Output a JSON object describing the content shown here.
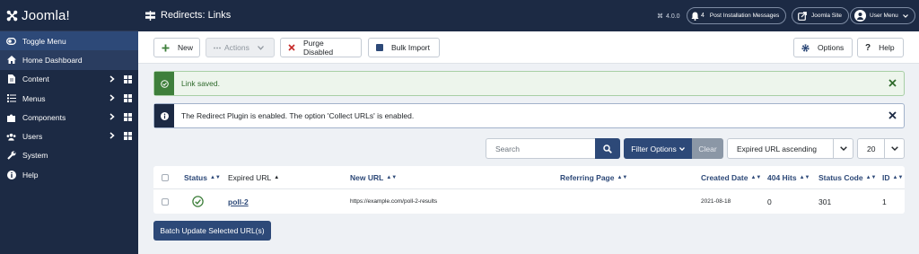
{
  "brand": {
    "name": "Joomla!"
  },
  "sidebar": {
    "items": [
      {
        "label": "Toggle Menu",
        "icon": "toggle-icon"
      },
      {
        "label": "Home Dashboard",
        "icon": "home-icon"
      },
      {
        "label": "Content",
        "icon": "file-icon"
      },
      {
        "label": "Menus",
        "icon": "list-icon"
      },
      {
        "label": "Components",
        "icon": "puzzle-icon"
      },
      {
        "label": "Users",
        "icon": "users-icon"
      },
      {
        "label": "System",
        "icon": "wrench-icon"
      },
      {
        "label": "Help",
        "icon": "info-icon"
      }
    ]
  },
  "header": {
    "title": "Redirects: Links",
    "version": "4.0.0",
    "notifications": {
      "count": "4",
      "label": "Post Installation Messages"
    },
    "site_link": "Joomla Site",
    "user_menu": "User Menu"
  },
  "toolbar": {
    "new_label": "New",
    "actions_label": "Actions",
    "purge_label": "Purge Disabled",
    "bulk_label": "Bulk Import",
    "options_label": "Options",
    "help_label": "Help"
  },
  "alerts": {
    "success": "Link saved.",
    "info": "The Redirect Plugin is enabled. The option 'Collect URLs' is enabled."
  },
  "filters": {
    "search_placeholder": "Search",
    "filter_options_label": "Filter Options",
    "clear_label": "Clear",
    "ordering": "Expired URL ascending",
    "limit": "20"
  },
  "table": {
    "headers": {
      "status": "Status",
      "expired_url": "Expired URL",
      "new_url": "New URL",
      "referring_page": "Referring Page",
      "created_date": "Created Date",
      "hits": "404 Hits",
      "status_code": "Status Code",
      "id": "ID"
    },
    "rows": [
      {
        "expired_url": "poll-2",
        "new_url": "https://example.com/poll-2-results",
        "referring_page": "",
        "created_date": "2021-08-18",
        "hits": "0",
        "status_code": "301",
        "id": "1"
      }
    ]
  },
  "batch_label": "Batch Update Selected URL(s)",
  "colors": {
    "navy": "#1c2a44",
    "primary": "#2d4978",
    "success": "#3e7f3b",
    "danger": "#c52827"
  }
}
